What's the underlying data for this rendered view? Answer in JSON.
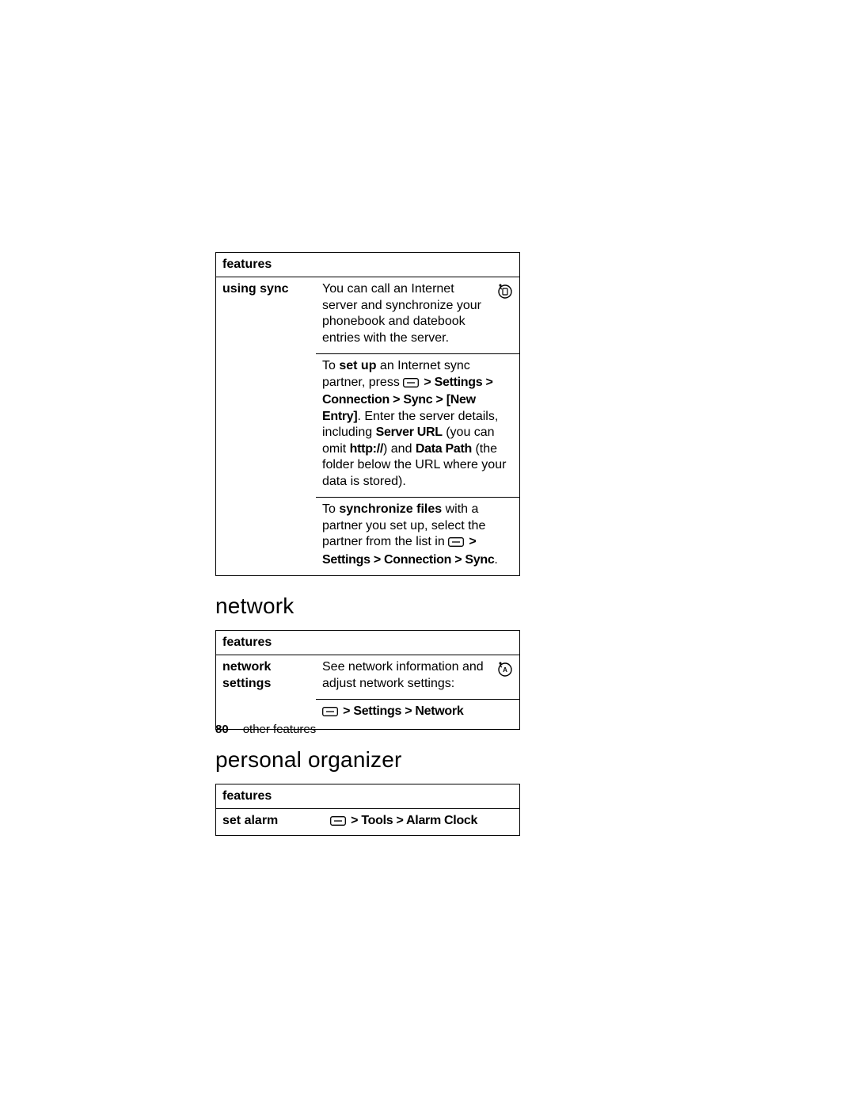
{
  "tables": {
    "sync": {
      "header": "features",
      "row_label": "using sync",
      "p1": {
        "pre": "You can call an Internet server and synchronize your phonebook and datebook entries with the server."
      },
      "p2": {
        "a": "To ",
        "b": "set up",
        "c": " an Internet sync partner, press ",
        "path": " > Settings > Connection > Sync > [New Entry]",
        "d": ". Enter the server details, including ",
        "e": "Server URL",
        "f": " (you can omit ",
        "g": "http://",
        "h": ") and ",
        "i": "Data Path",
        "j": " (the folder below the URL where your data is stored)."
      },
      "p3": {
        "a": "To ",
        "b": "synchronize files",
        "c": " with a partner you set up, select the partner from the list in ",
        "path": " > Settings > Connection > Sync",
        "d": "."
      }
    },
    "network": {
      "header": "features",
      "row_label_1": "network",
      "row_label_2": "settings",
      "desc": "See network information and adjust network settings:",
      "path": " > Settings > Network"
    },
    "organizer": {
      "header": "features",
      "row_label": "set alarm",
      "path": " > Tools > Alarm Clock"
    }
  },
  "headings": {
    "network": "network",
    "organizer": "personal organizer"
  },
  "footer": {
    "pageno": "80",
    "section": "other features"
  }
}
